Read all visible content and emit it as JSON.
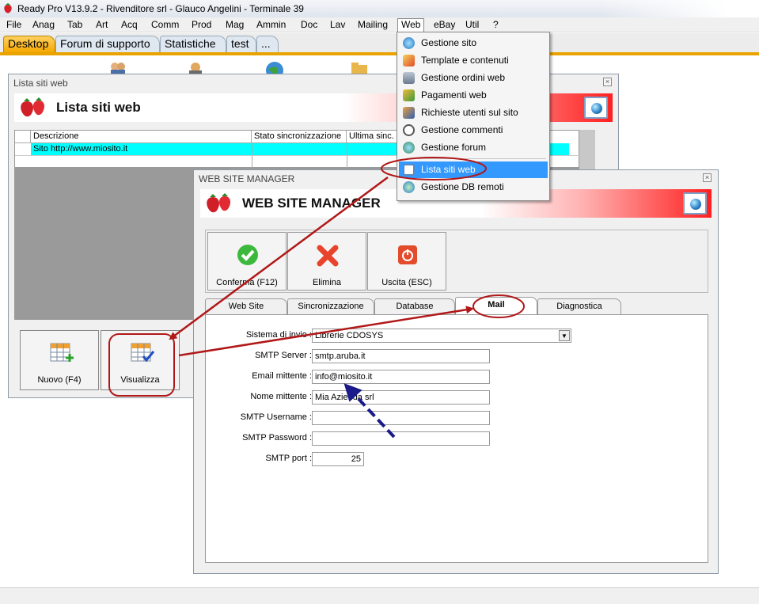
{
  "titlebar": {
    "title": "Ready Pro V13.9.2 - Rivenditore srl - Glauco Angelini - Terminale 39"
  },
  "menubar": [
    "File",
    "Anag",
    "Tab",
    "Art",
    "Acq",
    "Comm",
    "Prod",
    "Mag",
    "Ammin",
    "Doc",
    "Lav",
    "Mailing",
    "Web",
    "eBay",
    "Util",
    "?"
  ],
  "tabs": [
    "Desktop",
    "Forum di supporto",
    "Statistiche",
    "test",
    "..."
  ],
  "web_menu": {
    "items": [
      {
        "label": "Gestione sito",
        "icon": "globe-icon"
      },
      {
        "label": "Template e contenuti",
        "icon": "template-icon"
      },
      {
        "label": "Gestione ordini web",
        "icon": "orders-icon"
      },
      {
        "label": "Pagamenti web",
        "icon": "payments-icon"
      },
      {
        "label": "Richieste utenti sul sito",
        "icon": "user-requests-icon"
      },
      {
        "label": "Gestione commenti",
        "icon": "comments-icon"
      },
      {
        "label": "Gestione forum",
        "icon": "forum-icon"
      },
      {
        "label": "Lista siti web",
        "icon": "sites-list-icon"
      },
      {
        "label": "Gestione DB remoti",
        "icon": "remote-db-icon"
      }
    ]
  },
  "lista": {
    "window_title": "Lista siti web",
    "banner_title": "Lista siti web",
    "columns": [
      "Descrizione",
      "Stato sincronizzazione",
      "Ultima sinc."
    ],
    "rows": [
      [
        "Sito http://www.miosito.it",
        "",
        ""
      ]
    ],
    "new_label": "Nuovo (F4)",
    "view_label": "Visualizza"
  },
  "wsm": {
    "window_title": "WEB SITE MANAGER",
    "banner_title": "WEB SITE MANAGER",
    "confirm_label": "Conferma (F12)",
    "delete_label": "Elimina",
    "exit_label": "Uscita (ESC)",
    "tabs": [
      "Web Site",
      "Sincronizzazione",
      "Database",
      "Mail",
      "Diagnostica"
    ],
    "fields": {
      "send_system": {
        "label": "Sistema di invio :",
        "value": "Librerie CDOSYS"
      },
      "smtp_server": {
        "label": "SMTP Server :",
        "value": "smtp.aruba.it"
      },
      "sender_email": {
        "label": "Email mittente :",
        "value": "info@miosito.it"
      },
      "sender_name": {
        "label": "Nome mittente :",
        "value": "Mia Azienda srl"
      },
      "smtp_username": {
        "label": "SMTP Username :",
        "value": ""
      },
      "smtp_password": {
        "label": "SMTP Password :",
        "value": ""
      },
      "smtp_port": {
        "label": "SMTP port :",
        "value": "25"
      }
    }
  }
}
